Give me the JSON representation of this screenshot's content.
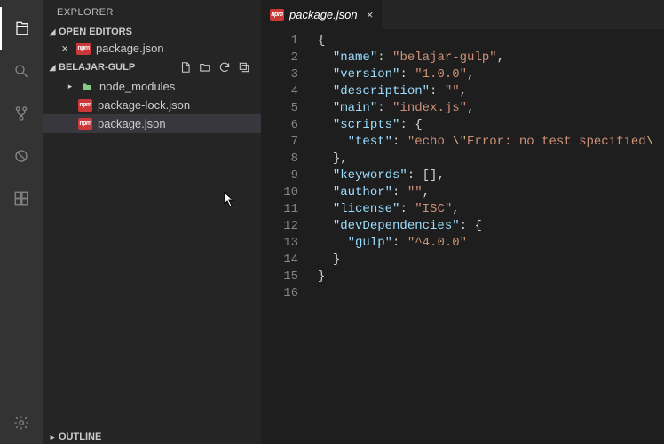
{
  "sidebar": {
    "title": "EXPLORER",
    "sections": {
      "openEditors": {
        "label": "OPEN EDITORS",
        "items": [
          {
            "name": "package.json"
          }
        ]
      },
      "project": {
        "label": "BELAJAR-GULP",
        "files": [
          {
            "name": "node_modules",
            "type": "folder"
          },
          {
            "name": "package-lock.json",
            "type": "npm"
          },
          {
            "name": "package.json",
            "type": "npm",
            "selected": true
          }
        ]
      },
      "outline": {
        "label": "OUTLINE"
      }
    }
  },
  "tab": {
    "name": "package.json"
  },
  "code": {
    "lineCount": 16,
    "json": {
      "name": "belajar-gulp",
      "version": "1.0.0",
      "description": "",
      "main": "index.js",
      "scripts_test": "echo \\\"Error: no test specified\\",
      "keywords_repr": "[]",
      "author": "",
      "license": "ISC",
      "dev_gulp": "^4.0.0"
    }
  }
}
